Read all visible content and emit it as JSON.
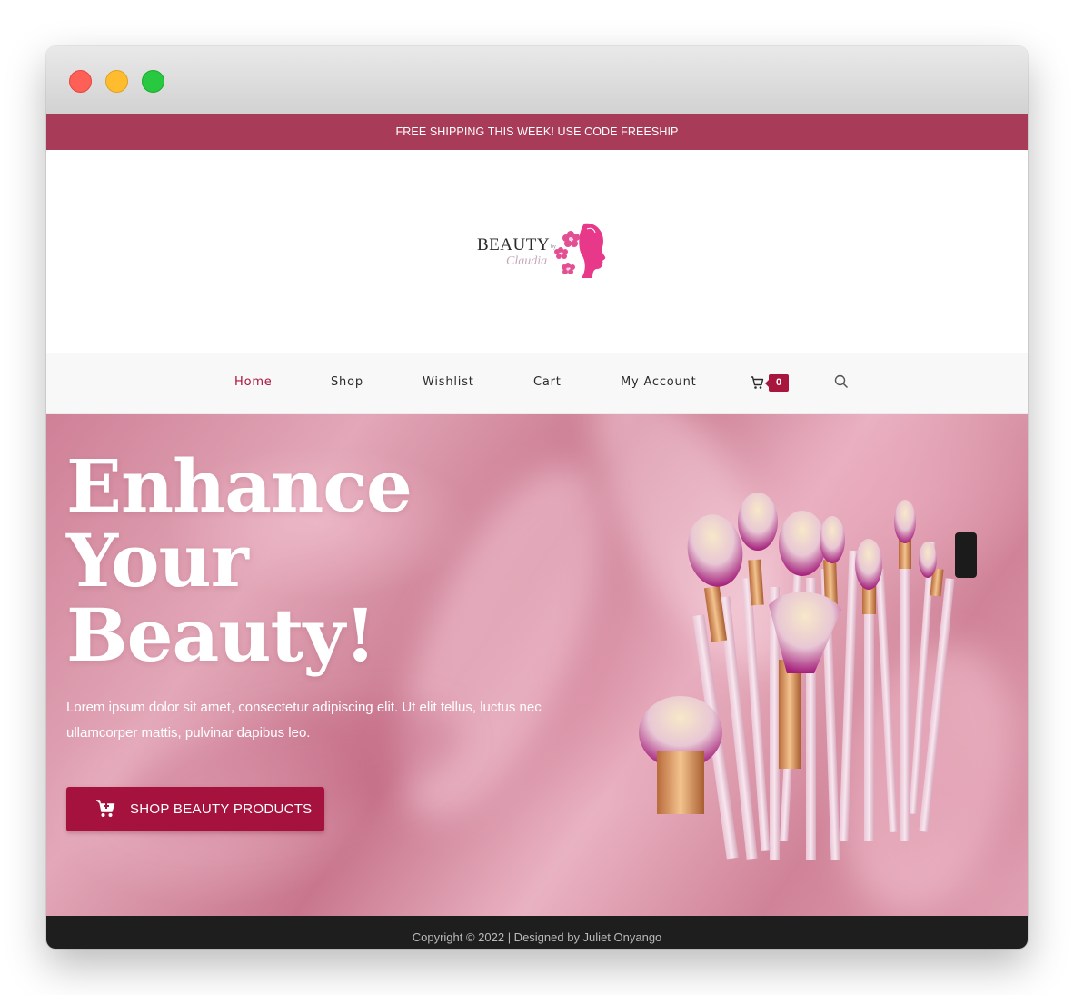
{
  "promo": {
    "text": "FREE SHIPPING THIS WEEK! USE CODE FREESHIP"
  },
  "logo": {
    "wordmark": "BEAUTY",
    "by": "by",
    "script": "Claudia"
  },
  "nav": {
    "items": [
      {
        "label": "Home",
        "active": true
      },
      {
        "label": "Shop"
      },
      {
        "label": "Wishlist"
      },
      {
        "label": "Cart"
      },
      {
        "label": "My Account"
      }
    ],
    "cart_count": "0",
    "icons": {
      "cart": "cart-icon",
      "search": "search-icon"
    }
  },
  "hero": {
    "title_line1": "Enhance",
    "title_line2": "Your",
    "title_line3": "Beauty!",
    "body": "Lorem ipsum dolor sit amet, consectetur adipiscing elit. Ut elit tellus, luctus nec ullamcorper mattis, pulvinar dapibus leo.",
    "button_label": "SHOP BEAUTY PRODUCTS",
    "button_icon": "cart-icon"
  },
  "footer": {
    "text": "Copyright © 2022 | Designed by Juliet Onyango"
  },
  "colors": {
    "promo_bar": "#a83c58",
    "accent": "#a5123d",
    "footer": "#1e1e1e"
  }
}
